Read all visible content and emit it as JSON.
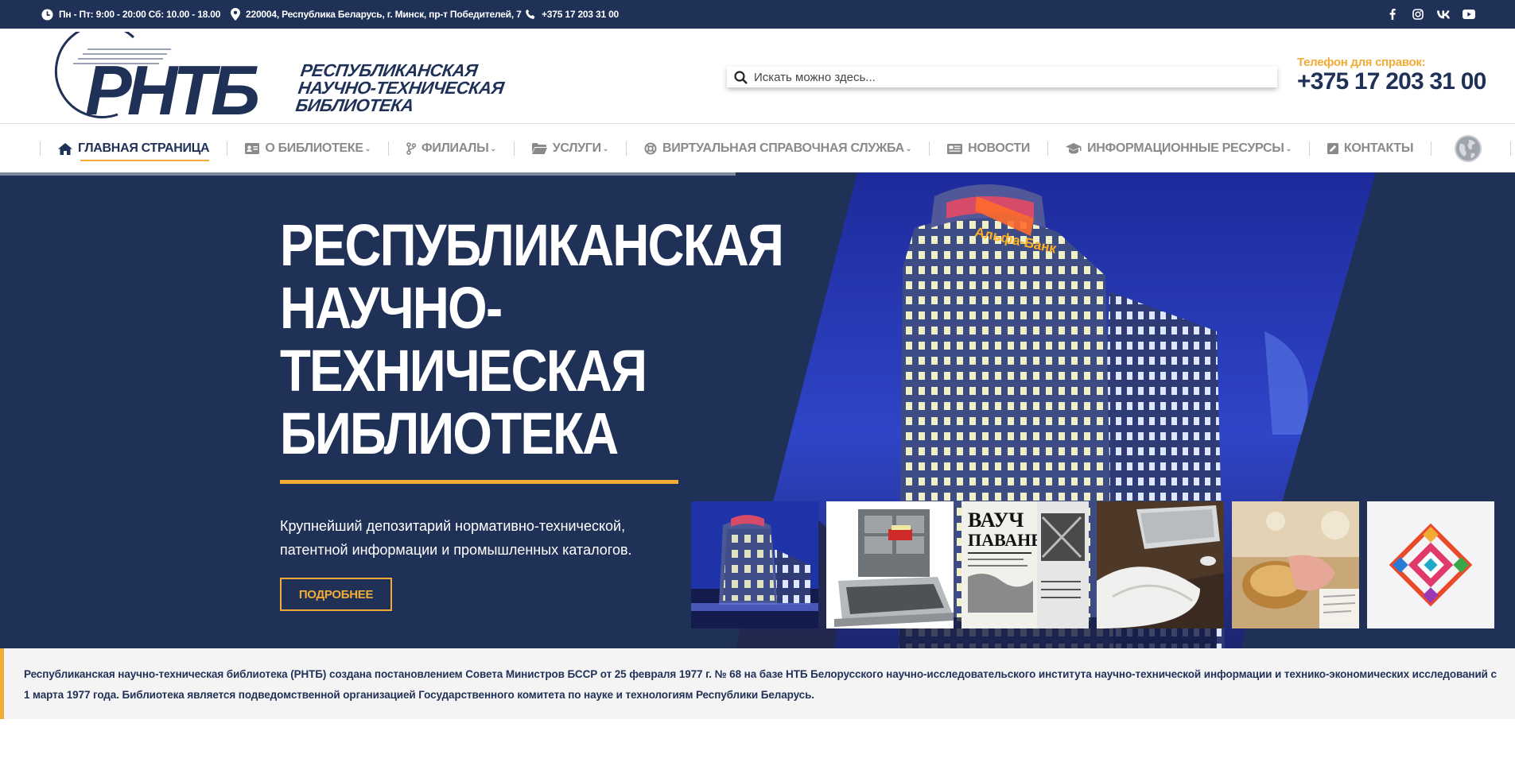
{
  "topbar": {
    "hours": "Пн - Пт: 9:00 - 20:00 Сб: 10.00 - 18.00",
    "address": "220004, Республика Беларусь, г. Минск, пр-т Победителей, 7",
    "phone": "+375 17 203 31 00",
    "social_icons": [
      "facebook-icon",
      "instagram-icon",
      "vk-icon",
      "youtube-icon"
    ]
  },
  "logo": {
    "mark": "РНТБ",
    "name_lines": [
      "РЕСПУБЛИКАНСКАЯ",
      "НАУЧНО-ТЕХНИЧЕСКАЯ",
      "БИБЛИОТЕКА"
    ]
  },
  "search": {
    "placeholder": "Искать можно здесь..."
  },
  "header_phone": {
    "label": "Телефон для справок:",
    "number": "+375 17 203 31 00"
  },
  "nav": {
    "items": [
      {
        "label": "ГЛАВНАЯ СТРАНИЦА",
        "icon": "home-icon",
        "active": true
      },
      {
        "label": "О БИБЛИОТЕКЕ",
        "icon": "id-card-icon",
        "dropdown": true
      },
      {
        "label": "ФИЛИАЛЫ",
        "icon": "branch-icon",
        "dropdown": true
      },
      {
        "label": "УСЛУГИ",
        "icon": "folder-icon",
        "dropdown": true
      },
      {
        "label": "ВИРТУАЛЬНАЯ СПРАВОЧНАЯ СЛУЖБА",
        "icon": "lifebuoy-icon",
        "dropdown": true
      },
      {
        "label": "НОВОСТИ",
        "icon": "newspaper-icon"
      },
      {
        "label": "ИНФОРМАЦИОННЫЕ РЕСУРСЫ",
        "icon": "graduation-cap-icon",
        "dropdown": true
      },
      {
        "label": "КОНТАКТЫ",
        "icon": "edit-icon"
      }
    ],
    "language_icon": "globe-icon"
  },
  "hero": {
    "title_lines": [
      "РЕСПУБЛИКАНСКАЯ",
      "НАУЧНО-",
      "ТЕХНИЧЕСКАЯ",
      "БИБЛИОТЕКА"
    ],
    "description_lines": [
      "Крупнейший депозитарий нормативно-технической,",
      "патентной информации и промышленных каталогов."
    ],
    "button": "ПОДРОБНЕЕ",
    "bank_sign": "Альфа-Банк",
    "thumbnail_count": 6
  },
  "intro": {
    "text": "Республиканская научно-техническая библиотека (РНТБ) создана постановлением Совета Министров БССР от 25 февраля 1977 г. № 68 на базе НТБ Белорусского научно-исследовательского института научно-технической информации и технико-экономических исследований с 1 марта 1977 года. Библиотека является подведомственной организацией Государственного комитета по науке и технологиям Республики Беларусь."
  },
  "colors": {
    "navy": "#1f3157",
    "accent": "#f2ac35",
    "nav_gray": "#8a8a8a",
    "intro_bg": "#f4f4f4"
  }
}
